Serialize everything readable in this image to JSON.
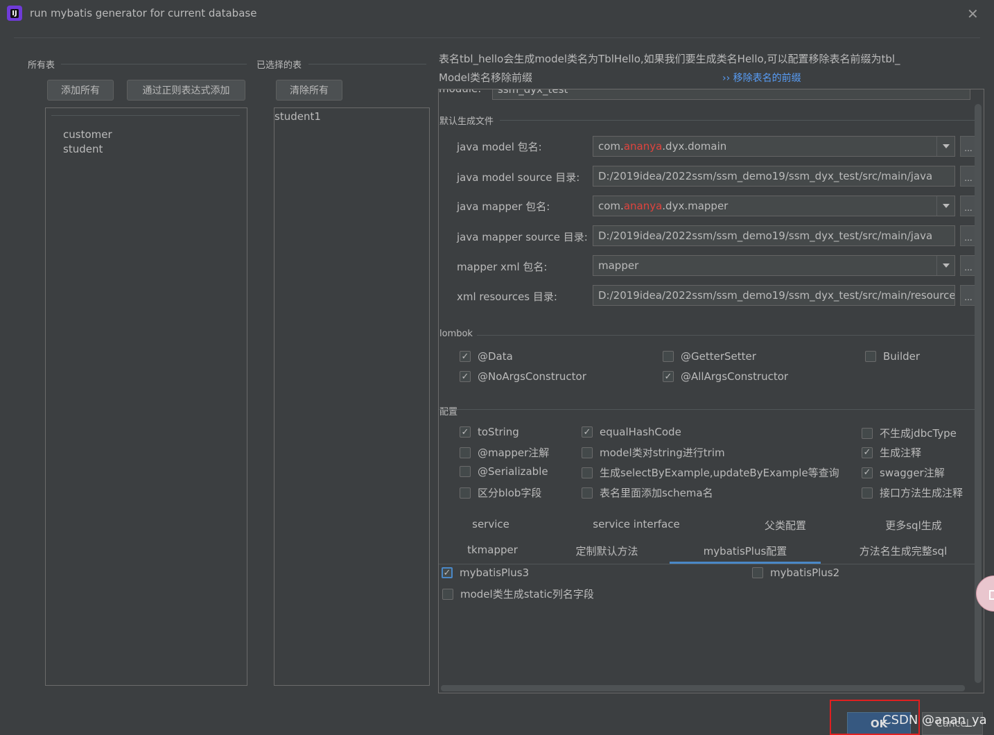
{
  "window": {
    "title": "run mybatis generator for current database",
    "close_icon": "close-icon"
  },
  "left": {
    "all_tables_label": "所有表",
    "add_all_button": "添加所有",
    "add_regex_button": "通过正则表达式添加",
    "tables": [
      "customer",
      "student"
    ]
  },
  "middle": {
    "selected_label": "已选择的表",
    "clear_all_button": "清除所有",
    "selected_tables": [
      "student1"
    ]
  },
  "info": {
    "line1": "表名tbl_hello会生成model类名为TblHello,如果我们要生成类名Hello,可以配置移除表名前缀为tbl_",
    "line2": "Model类名移除前缀",
    "link_arrow": "››",
    "link": "移除表名的前缀"
  },
  "module": {
    "label": "module:",
    "value": "ssm_dyx_test"
  },
  "default_files": {
    "section_label": "默认生成文件",
    "rows": [
      {
        "label": "java model 包名:",
        "prefix": "com.",
        "highlight": "ananya",
        "suffix": ".dyx.domain",
        "combo": true
      },
      {
        "label": "java model source 目录:",
        "value": "D:/2019idea/2022ssm/ssm_demo19/ssm_dyx_test/src/main/java",
        "combo": false
      },
      {
        "label": "java mapper 包名:",
        "prefix": "com.",
        "highlight": "ananya",
        "suffix": ".dyx.mapper",
        "combo": true
      },
      {
        "label": "java mapper source 目录:",
        "value": "D:/2019idea/2022ssm/ssm_demo19/ssm_dyx_test/src/main/java",
        "combo": false
      },
      {
        "label": "mapper xml 包名:",
        "value": "mapper",
        "combo": true
      },
      {
        "label": "xml resources 目录:",
        "value": "D:/2019idea/2022ssm/ssm_demo19/ssm_dyx_test/src/main/resources",
        "combo": false
      }
    ],
    "browse_label": "..."
  },
  "lombok": {
    "section_label": "lombok",
    "options": [
      {
        "label": "@Data",
        "checked": true
      },
      {
        "label": "@GetterSetter",
        "checked": false
      },
      {
        "label": "Builder",
        "checked": false
      },
      {
        "label": "@NoArgsConstructor",
        "checked": true
      },
      {
        "label": "@AllArgsConstructor",
        "checked": true
      }
    ]
  },
  "config": {
    "section_label": "配置",
    "options": [
      {
        "label": "toString",
        "checked": true
      },
      {
        "label": "equalHashCode",
        "checked": true
      },
      {
        "label": "不生成jdbcType",
        "checked": false
      },
      {
        "label": "@mapper注解",
        "checked": false
      },
      {
        "label": "model类对string进行trim",
        "checked": false
      },
      {
        "label": "生成注释",
        "checked": true
      },
      {
        "label": "@Serializable",
        "checked": false
      },
      {
        "label": "生成selectByExample,updateByExample等查询",
        "checked": false
      },
      {
        "label": "swagger注解",
        "checked": true
      },
      {
        "label": "区分blob字段",
        "checked": false
      },
      {
        "label": "表名里面添加schema名",
        "checked": false
      },
      {
        "label": "接口方法生成注释",
        "checked": false
      }
    ]
  },
  "tabs": {
    "row1": [
      "service",
      "service interface",
      "父类配置",
      "更多sql生成"
    ],
    "row2": [
      "tkmapper",
      "定制默认方法",
      "mybatisPlus配置",
      "方法名生成完整sql"
    ],
    "active": "mybatisPlus配置"
  },
  "mybatis_plus": {
    "options": [
      {
        "label": "mybatisPlus3",
        "checked": true
      },
      {
        "label": "mybatisPlus2",
        "checked": false
      },
      {
        "label": "model类生成static列名字段",
        "checked": false
      }
    ]
  },
  "footer": {
    "ok_button": "OK",
    "cancel_button": "Cancel",
    "watermark": "CSDN @anan_ya"
  },
  "colors": {
    "background": "#3c3f41",
    "accent": "#4a88c7",
    "highlight_red": "#e0443e",
    "annotation_red": "#e02020"
  }
}
